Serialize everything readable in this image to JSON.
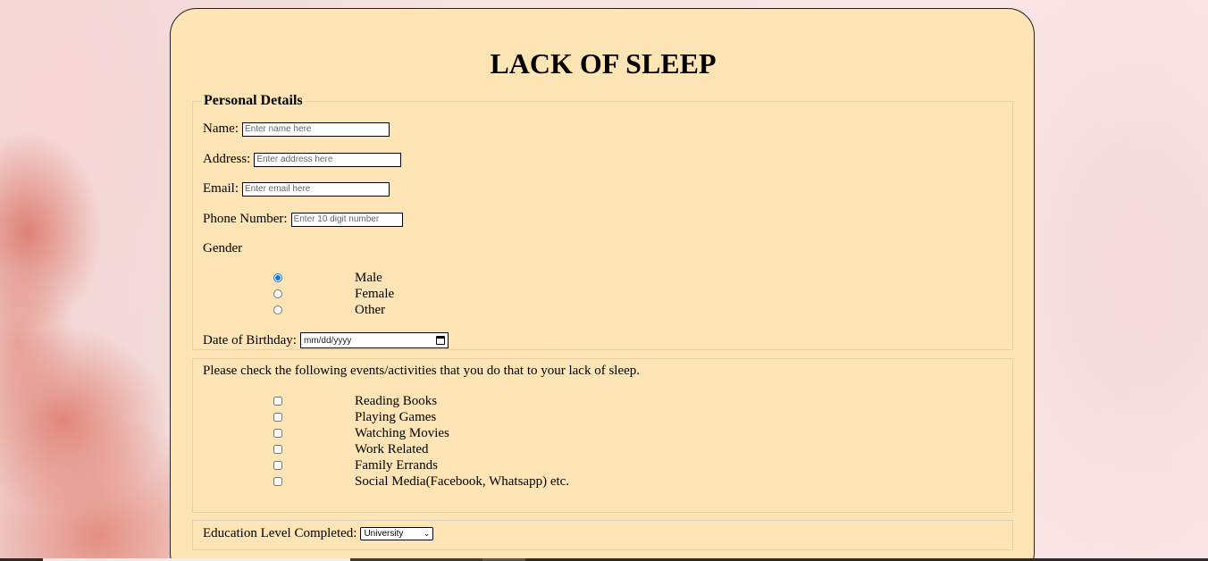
{
  "page": {
    "title": "LACK OF SLEEP"
  },
  "personal": {
    "legend": "Personal Details",
    "name_label": "Name:",
    "name_placeholder": "Enter name here",
    "address_label": "Address:",
    "address_placeholder": "Enter address here",
    "email_label": "Email:",
    "email_placeholder": "Enter email here",
    "phone_label": "Phone Number:",
    "phone_placeholder": "Enter 10 digit number",
    "gender_label": "Gender",
    "gender_options": [
      {
        "label": "Male",
        "checked": true
      },
      {
        "label": "Female",
        "checked": false
      },
      {
        "label": "Other",
        "checked": false
      }
    ],
    "dob_label": "Date of Birthday:",
    "dob_placeholder": "mm/dd/yyyy",
    "dob_icon": "calendar-icon"
  },
  "activities": {
    "prompt": "Please check the following events/activities that you do that to your lack of sleep.",
    "options": [
      {
        "label": "Reading Books",
        "checked": false
      },
      {
        "label": "Playing Games",
        "checked": false
      },
      {
        "label": "Watching Movies",
        "checked": false
      },
      {
        "label": "Work Related",
        "checked": false
      },
      {
        "label": "Family Errands",
        "checked": false
      },
      {
        "label": "Social Media(Facebook, Whatsapp) etc.",
        "checked": false
      }
    ]
  },
  "education": {
    "label": "Education Level Completed:",
    "selected": "University",
    "dropdown_icon": "chevron-down-icon"
  },
  "colors": {
    "card_background": "#ffe4b5",
    "radio_accent": "#1a73e8"
  }
}
